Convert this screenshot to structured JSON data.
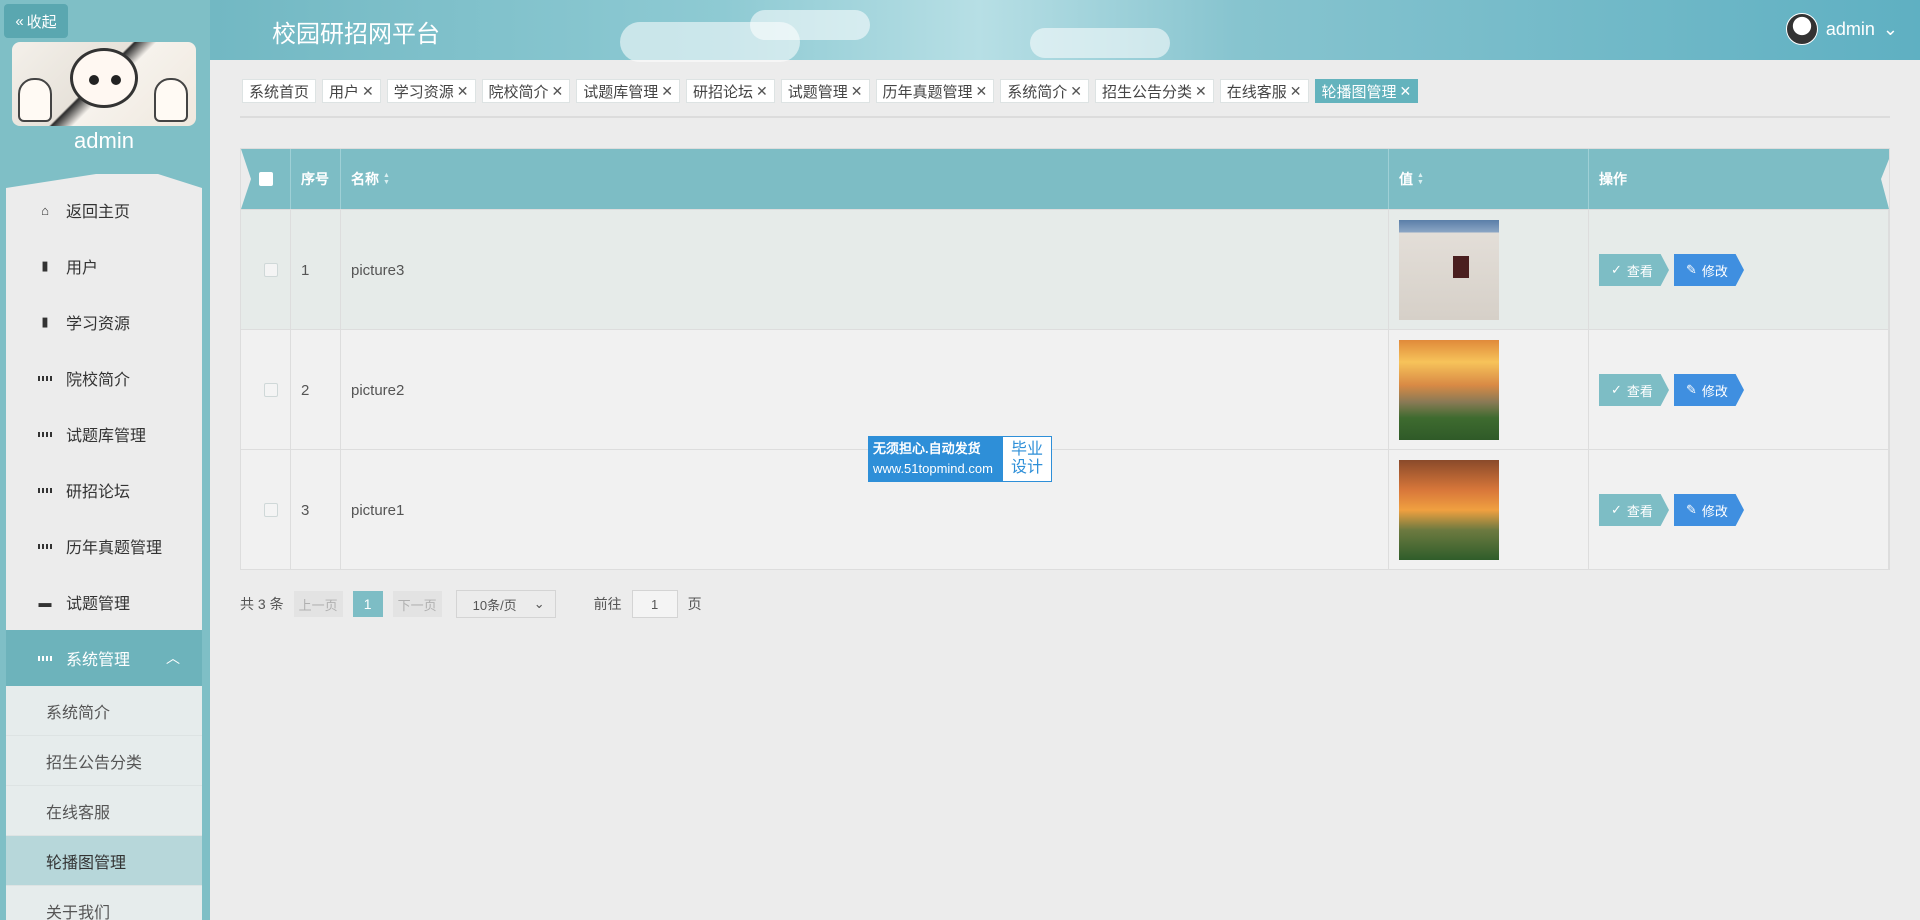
{
  "sidebar": {
    "collapse_label": "收起",
    "admin_name": "admin",
    "menu": [
      {
        "label": "返回主页",
        "icon": "home-icon"
      },
      {
        "label": "用户",
        "icon": "clipboard-icon"
      },
      {
        "label": "学习资源",
        "icon": "book-icon"
      },
      {
        "label": "院校简介",
        "icon": "grid-icon"
      },
      {
        "label": "试题库管理",
        "icon": "grid-icon"
      },
      {
        "label": "研招论坛",
        "icon": "grid-icon"
      },
      {
        "label": "历年真题管理",
        "icon": "grid-icon"
      },
      {
        "label": "试题管理",
        "icon": "briefcase-icon"
      }
    ],
    "system_menu": {
      "label": "系统管理",
      "caret": "︿"
    },
    "submenu": [
      "系统简介",
      "招生公告分类",
      "在线客服",
      "轮播图管理",
      "关于我们"
    ],
    "current_submenu": "轮播图管理"
  },
  "header": {
    "title": "校园研招网平台",
    "user": "admin",
    "caret": "⌄"
  },
  "tags": [
    {
      "label": "系统首页",
      "closable": false
    },
    {
      "label": "用户",
      "closable": true
    },
    {
      "label": "学习资源",
      "closable": true
    },
    {
      "label": "院校简介",
      "closable": true
    },
    {
      "label": "试题库管理",
      "closable": true
    },
    {
      "label": "研招论坛",
      "closable": true
    },
    {
      "label": "试题管理",
      "closable": true
    },
    {
      "label": "历年真题管理",
      "closable": true
    },
    {
      "label": "系统简介",
      "closable": true
    },
    {
      "label": "招生公告分类",
      "closable": true
    },
    {
      "label": "在线客服",
      "closable": true
    },
    {
      "label": "轮播图管理",
      "closable": true,
      "active": true
    }
  ],
  "table": {
    "headers": {
      "index": "序号",
      "name": "名称",
      "value": "值",
      "ops": "操作"
    },
    "rows": [
      {
        "index": "1",
        "name": "picture3",
        "image": "building-photo"
      },
      {
        "index": "2",
        "name": "picture2",
        "image": "sunset-campus-photo"
      },
      {
        "index": "3",
        "name": "picture1",
        "image": "evening-trees-photo"
      }
    ],
    "view_label": "查看",
    "edit_label": "修改"
  },
  "pager": {
    "total": "共 3 条",
    "prev": "上一页",
    "current": "1",
    "next": "下一页",
    "size": "10条/页",
    "goto_prefix": "前往",
    "goto_value": "1",
    "goto_suffix": "页"
  },
  "watermark": {
    "line1": "无须担心.自动发货",
    "line2": "www.51topmind.com",
    "right1": "毕业",
    "right2": "设计"
  },
  "colors": {
    "accent": "#7dbdc5",
    "edit": "#3f8fe0",
    "active_tag": "#64b3bd"
  }
}
